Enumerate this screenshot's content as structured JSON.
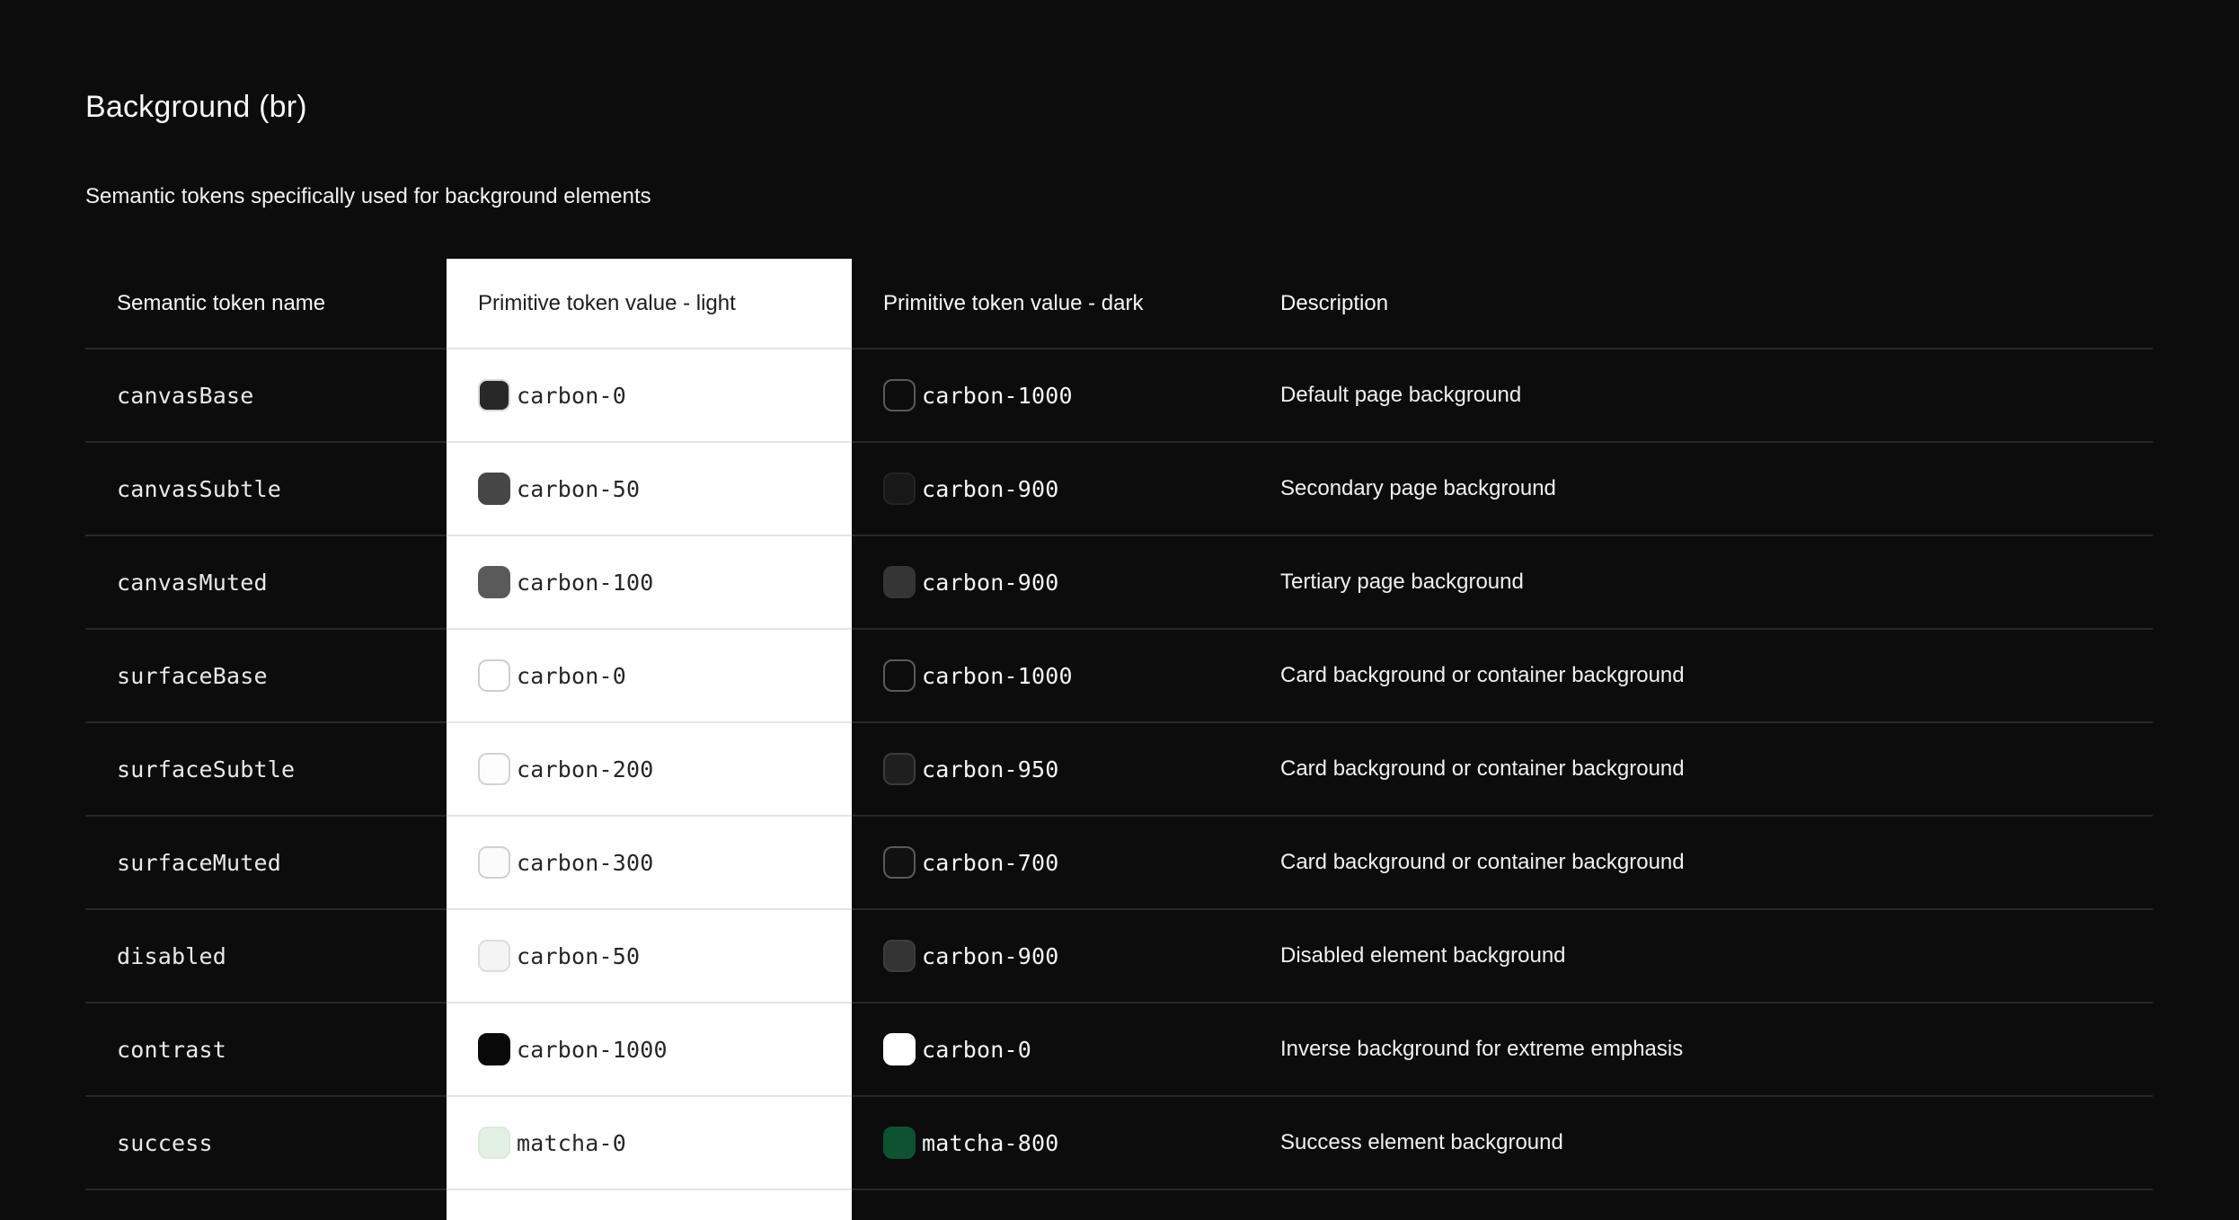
{
  "page": {
    "title": "Background (br)",
    "subtitle": "Semantic tokens specifically used for background elements"
  },
  "colors": {
    "page_background": "#0c0c0c",
    "highlight_column_background": "#ffffff",
    "divider_on_dark": "#282828",
    "divider_on_light": "#e4e4e4",
    "text_on_dark": "#f2f2f2",
    "text_on_light": "#262626"
  },
  "table": {
    "columns": [
      "Semantic token name",
      "Primitive token value - light",
      "Primitive token value - dark",
      "Description"
    ],
    "rows": [
      {
        "token": "canvasBase",
        "light": {
          "label": "carbon-0",
          "fill": "#282828",
          "border": "#d9d9d9"
        },
        "dark": {
          "label": "carbon-1000",
          "fill": "#0c0c0c",
          "border": "#5a5a5a"
        },
        "description": "Default page background"
      },
      {
        "token": "canvasSubtle",
        "light": {
          "label": "carbon-50",
          "fill": "#464646",
          "border": "#464646"
        },
        "dark": {
          "label": "carbon-900",
          "fill": "#181818",
          "border": "#242424"
        },
        "description": "Secondary page background"
      },
      {
        "token": "canvasMuted",
        "light": {
          "label": "carbon-100",
          "fill": "#5a5a5a",
          "border": "#5a5a5a"
        },
        "dark": {
          "label": "carbon-900",
          "fill": "#353535",
          "border": "#353535"
        },
        "description": "Tertiary page background"
      },
      {
        "token": "surfaceBase",
        "light": {
          "label": "carbon-0",
          "fill": "#ffffff",
          "border": "#cfcfcf"
        },
        "dark": {
          "label": "carbon-1000",
          "fill": "#0c0c0c",
          "border": "#5a5a5a"
        },
        "description": "Card background or container background"
      },
      {
        "token": "surfaceSubtle",
        "light": {
          "label": "carbon-200",
          "fill": "#fdfdfd",
          "border": "#d2d2d2"
        },
        "dark": {
          "label": "carbon-950",
          "fill": "#1f1f1f",
          "border": "#3c3c3c"
        },
        "description": "Card background or container background"
      },
      {
        "token": "surfaceMuted",
        "light": {
          "label": "carbon-300",
          "fill": "#fbfbfb",
          "border": "#d2d2d2"
        },
        "dark": {
          "label": "carbon-700",
          "fill": "#111111",
          "border": "#5a5a5a"
        },
        "description": "Card background or container background"
      },
      {
        "token": "disabled",
        "light": {
          "label": "carbon-50",
          "fill": "#f4f4f4",
          "border": "#dddddd"
        },
        "dark": {
          "label": "carbon-900",
          "fill": "#333333",
          "border": "#3d3d3d"
        },
        "description": "Disabled element background"
      },
      {
        "token": "contrast",
        "light": {
          "label": "carbon-1000",
          "fill": "#0a0a0a",
          "border": "#0a0a0a"
        },
        "dark": {
          "label": "carbon-0",
          "fill": "#ffffff",
          "border": "#ffffff"
        },
        "description": "Inverse background for extreme emphasis"
      },
      {
        "token": "success",
        "light": {
          "label": "matcha-0",
          "fill": "#e2f1e4",
          "border": "#d9ecdb"
        },
        "dark": {
          "label": "matcha-800",
          "fill": "#0d5231",
          "border": "#0d5231"
        },
        "description": "Success element background"
      }
    ]
  }
}
